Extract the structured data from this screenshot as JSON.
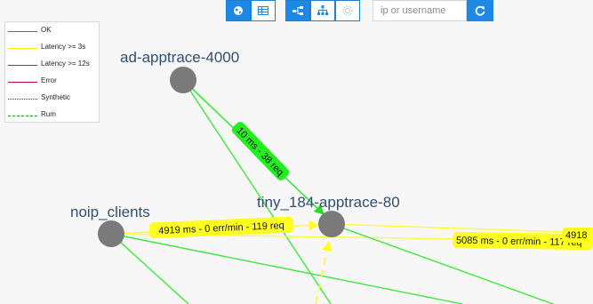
{
  "toolbar": {
    "view_buttons": [
      {
        "icon": "globe-icon",
        "active": true
      },
      {
        "icon": "table-icon",
        "active": false
      }
    ],
    "layout_buttons": [
      {
        "icon": "tree-horizontal-icon",
        "active": true
      },
      {
        "icon": "tree-vertical-icon",
        "active": false
      },
      {
        "icon": "circle-layout-icon",
        "active": false
      }
    ],
    "search_placeholder": "ip or username",
    "refresh_icon": "refresh-icon"
  },
  "legend": [
    {
      "label": "OK",
      "color": "#1f9e1f",
      "style": "solid"
    },
    {
      "label": "Latency >= 3s",
      "color": "#f0f000",
      "style": "solid"
    },
    {
      "label": "Latency >= 12s",
      "color": "#cc00cc",
      "style": "solid"
    },
    {
      "label": "Error",
      "color": "#cc0033",
      "style": "solid"
    },
    {
      "label": "Synthetic",
      "color": "#333333",
      "style": "dotted"
    },
    {
      "label": "Rum",
      "color": "#1f9e1f",
      "style": "dashed"
    }
  ],
  "colors": {
    "ok_edge": "#3ee83e",
    "latency_edge": "#ffff33",
    "node": "#7a7a7a",
    "ok_badge": "#22ee22",
    "latency_badge": "#ffff22",
    "accent": "#1e88e5"
  },
  "nodes": {
    "ad": {
      "label": "ad-apptrace-4000"
    },
    "noip": {
      "label": "noip_clients"
    },
    "tiny": {
      "label": "tiny_184-apptrace-80"
    }
  },
  "edge_labels": {
    "ad_to_tiny": "10 ms - 38 req",
    "noip_to_tiny": "4919 ms - 0 err/min - 119 req",
    "tiny_out": "5085 ms - 0 err/min - 117 req",
    "offscreen": "4918"
  }
}
